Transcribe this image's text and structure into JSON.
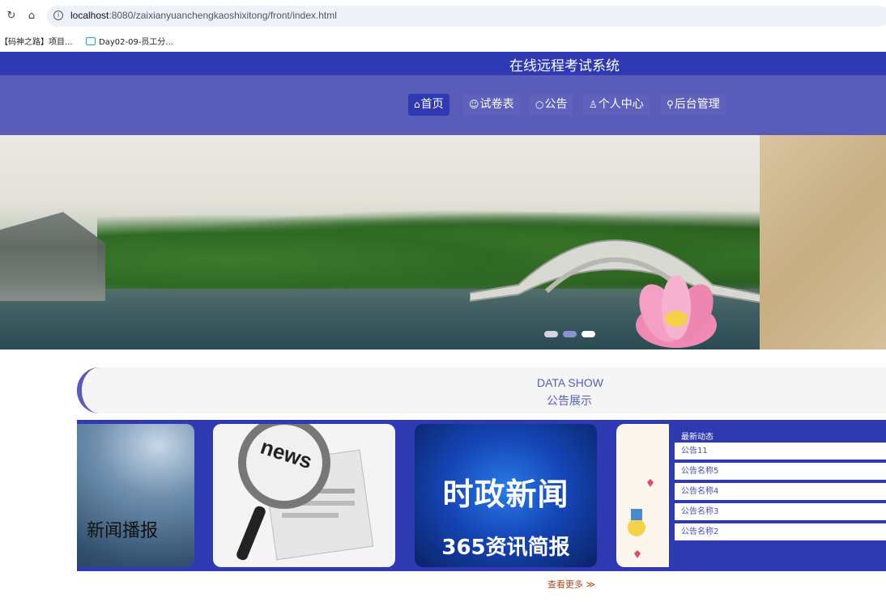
{
  "browser": {
    "url_host": "localhost",
    "url_rest": ":8080/zaixianyuanchengkaoshixitong/front/index.html",
    "bookmarks": [
      {
        "label": "【码神之路】项目..."
      },
      {
        "label": "Day02-09-员工分..."
      }
    ]
  },
  "header": {
    "site_title": "在线远程考试系统",
    "nav": [
      {
        "label": "首页",
        "icon": "home-icon",
        "glyph": "⌂"
      },
      {
        "label": "试卷表",
        "icon": "smile-icon",
        "glyph": "☺"
      },
      {
        "label": "公告",
        "icon": "circle-icon",
        "glyph": "○"
      },
      {
        "label": "个人中心",
        "icon": "user-icon",
        "glyph": "♙"
      },
      {
        "label": "后台管理",
        "icon": "link-icon",
        "glyph": "⚲"
      }
    ]
  },
  "section": {
    "title_en": "DATA SHOW",
    "title_zh": "公告展示"
  },
  "cards": {
    "card1_text": "新闻播报",
    "card2_text": "news",
    "card3_line1": "时政新闻",
    "card3_line2": "365资讯简报"
  },
  "latest": {
    "title": "最新动态",
    "items": [
      "公告11",
      "公告名称5",
      "公告名称4",
      "公告名称3",
      "公告名称2"
    ]
  },
  "more_label": "查看更多 ≫",
  "colors": {
    "primary": "#2f3ab2",
    "nav_bg": "#5a5cb9",
    "more_link": "#b04a1a"
  }
}
